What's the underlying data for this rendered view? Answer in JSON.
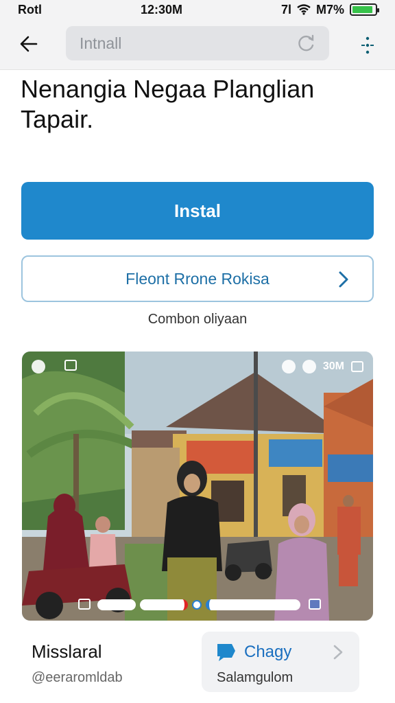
{
  "status_bar": {
    "carrier": "Rotl",
    "time": "12:30M",
    "signal_text": "7l",
    "battery_text": "M7%",
    "battery_level": 0.9
  },
  "browser": {
    "url_text": "Intnall",
    "back_icon": "arrow-left-icon",
    "reload_icon": "reload-icon",
    "menu_icon": "menu-icon"
  },
  "page": {
    "title": "Nenangia Negaa Planglian Tapair.",
    "install_label": "Instal",
    "secondary_label": "Fleont Rrone Rokisa",
    "caption": "Combon oliyaan"
  },
  "photo": {
    "overlay_time": "30M"
  },
  "footer": {
    "app_name": "Misslaral",
    "handle": "@eeraromldab",
    "chat_label": "Chagy",
    "chat_sub": "Salamgulom"
  },
  "colors": {
    "accent": "#1f88cc",
    "battery": "#37c24a"
  }
}
